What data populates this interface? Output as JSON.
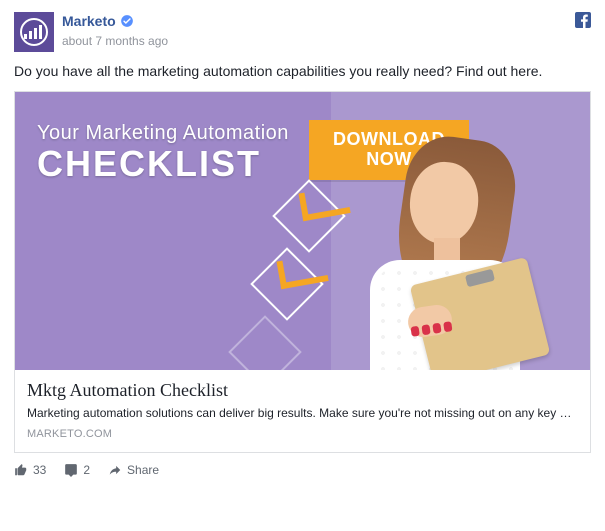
{
  "header": {
    "page_name": "Marketo",
    "timestamp": "about 7 months ago",
    "verified": true
  },
  "post": {
    "text": "Do you have all the marketing automation capabilities you really need? Find out here."
  },
  "hero": {
    "line1": "Your Marketing Automation",
    "line2": "CHECKLIST",
    "cta": "DOWNLOAD NOW"
  },
  "card": {
    "title": "Mktg Automation Checklist",
    "description": "Marketing automation solutions can deliver big results. Make sure you're not missing out on any key …",
    "domain": "MARKETO.COM"
  },
  "actions": {
    "like_count": "33",
    "comment_count": "2",
    "share_label": "Share"
  },
  "colors": {
    "brand_purple": "#5c4b99",
    "cta_orange": "#f5a623",
    "fb_blue": "#3b5998",
    "link_blue": "#365899"
  },
  "icons": {
    "verified": "verified-badge-icon",
    "facebook": "facebook-icon",
    "like": "thumbs-up-icon",
    "comment": "comment-icon",
    "share": "share-arrow-icon",
    "marketo": "marketo-logo-icon"
  }
}
